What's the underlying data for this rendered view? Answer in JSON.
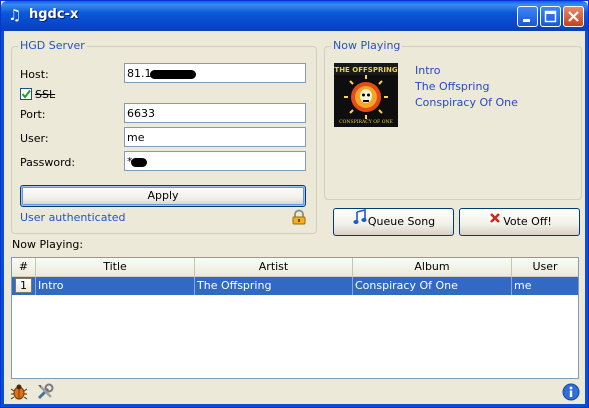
{
  "window": {
    "title": "hgdc-x",
    "icon": "music-note-icon"
  },
  "server": {
    "group_title": "HGD Server",
    "host_label": "Host:",
    "host_value": "81.1",
    "ssl_label": "SSL",
    "ssl_checked": true,
    "port_label": "Port:",
    "port_value": "6633",
    "user_label": "User:",
    "user_value": "me",
    "password_label": "Password:",
    "password_value": "*",
    "apply_label": "Apply",
    "status_text": "User authenticated",
    "lock_icon": "lock-icon"
  },
  "now_playing_panel": {
    "group_title": "Now Playing",
    "title": "Intro",
    "artist": "The Offspring",
    "album": "Conspiracy Of One",
    "album_art_text": "THE OFFSPRING",
    "album_art_subtext": "CONSPIRACY OF ONE"
  },
  "actions": {
    "queue_label": "Queue Song",
    "vote_label": "Vote Off!"
  },
  "playlist": {
    "label": "Now Playing:",
    "columns": [
      "#",
      "Title",
      "Artist",
      "Album",
      "User"
    ],
    "rows": [
      {
        "num": "1",
        "title": "Intro",
        "artist": "The Offspring",
        "album": "Conspiracy Of One",
        "user": "me"
      }
    ]
  },
  "colors": {
    "accent": "#2153c9",
    "selection": "#316ac5",
    "titlebar": "#0a58d8"
  }
}
